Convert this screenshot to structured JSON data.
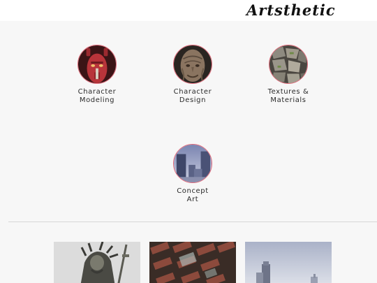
{
  "header": {
    "brand": "Artsthetic"
  },
  "categories": [
    {
      "label": "Character\nModeling",
      "icon": "red-demon-head-thumbnail"
    },
    {
      "label": "Character\nDesign",
      "icon": "old-face-sculpt-thumbnail"
    },
    {
      "label": "Textures &\nMaterials",
      "icon": "stone-wall-texture-thumbnail"
    },
    {
      "label": "Concept\nArt",
      "icon": "cityscape-concept-thumbnail"
    }
  ],
  "gallery": [
    {
      "icon": "warrior-sculpt-image"
    },
    {
      "icon": "brick-floor-texture-image"
    },
    {
      "icon": "foggy-tower-scene-image"
    }
  ],
  "colors": {
    "accent_ring": "#e46b7b",
    "background": "#f7f7f7",
    "header_background": "#ffffff"
  }
}
